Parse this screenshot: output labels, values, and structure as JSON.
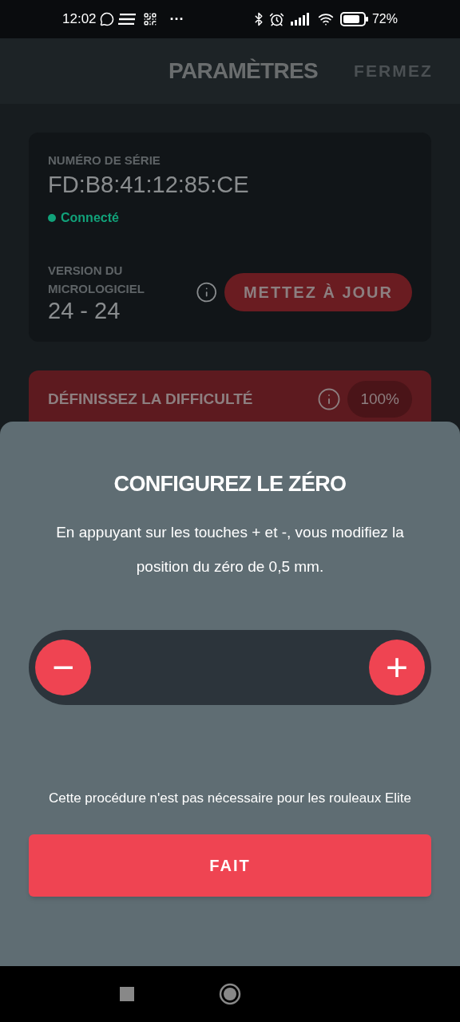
{
  "status_bar": {
    "time": "12:02",
    "more": "···",
    "battery": "72%"
  },
  "header": {
    "title": "PARAMÈTRES",
    "close": "FERMEZ"
  },
  "device_card": {
    "serial_label": "NUMÉRO DE SÉRIE",
    "serial": "FD:B8:41:12:85:CE",
    "status": {
      "label": "Connecté",
      "color": "#11a27a"
    },
    "firmware_label": "VERSION DU MICROLOGICIEL",
    "firmware": "24 - 24",
    "update_button": "METTEZ À JOUR"
  },
  "difficulty": {
    "label": "DÉFINISSEZ LA DIFFICULTÉ",
    "value": "100%"
  },
  "sheet": {
    "title": "CONFIGUREZ LE ZÉRO",
    "description": "En appuyant sur les touches + et -, vous modifiez la position du zéro de 0,5 mm.",
    "minus": "−",
    "plus": "+",
    "note": "Cette procédure n'est pas nécessaire pour les rouleaux Elite",
    "done": "FAIT"
  }
}
